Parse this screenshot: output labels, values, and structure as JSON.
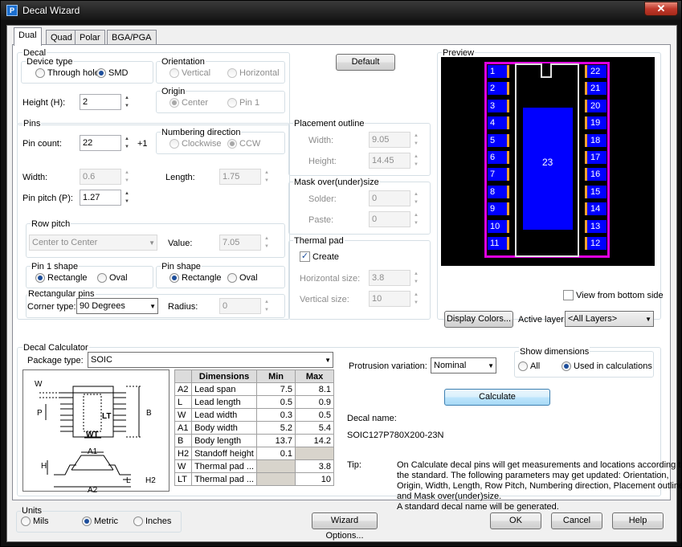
{
  "window": {
    "title": "Decal Wizard",
    "close": "✕"
  },
  "tabs": [
    "Dual",
    "Quad",
    "Polar",
    "BGA/PGA"
  ],
  "decal": {
    "group": "Decal",
    "device_type": {
      "label": "Device type",
      "through_hole": "Through hole",
      "smd": "SMD"
    },
    "orientation": {
      "label": "Orientation",
      "vertical": "Vertical",
      "horizontal": "Horizontal"
    },
    "height_label": "Height (H):",
    "height_value": "2",
    "origin": {
      "label": "Origin",
      "center": "Center",
      "pin1": "Pin 1"
    },
    "default_button": "Default"
  },
  "pins": {
    "group": "Pins",
    "pin_count_label": "Pin count:",
    "pin_count_value": "22",
    "plus1": "+1",
    "numbering": {
      "label": "Numbering direction",
      "clockwise": "Clockwise",
      "ccw": "CCW"
    },
    "width_label": "Width:",
    "width_value": "0.6",
    "length_label": "Length:",
    "length_value": "1.75",
    "pitch_label": "Pin pitch (P):",
    "pitch_value": "1.27",
    "row_pitch": {
      "label": "Row pitch",
      "mode": "Center to Center",
      "value_label": "Value:",
      "value": "7.05"
    },
    "pin1_shape": {
      "label": "Pin 1 shape",
      "rectangle": "Rectangle",
      "oval": "Oval"
    },
    "pin_shape": {
      "label": "Pin shape",
      "rectangle": "Rectangle",
      "oval": "Oval"
    },
    "rect_pins": {
      "label": "Rectangular pins",
      "corner_label": "Corner type:",
      "corner_value": "90 Degrees",
      "radius_label": "Radius:",
      "radius_value": "0"
    }
  },
  "placement": {
    "label": "Placement outline",
    "width_label": "Width:",
    "width_value": "9.05",
    "height_label": "Height:",
    "height_value": "14.45"
  },
  "mask": {
    "label": "Mask over(under)size",
    "solder_label": "Solder:",
    "solder_value": "0",
    "paste_label": "Paste:",
    "paste_value": "0"
  },
  "thermal": {
    "label": "Thermal pad",
    "create": "Create",
    "check": "✓",
    "hsize_label": "Horizontal size:",
    "hsize_value": "3.8",
    "vsize_label": "Vertical size:",
    "vsize_value": "10"
  },
  "preview": {
    "label": "Preview",
    "left_pins": [
      "1",
      "2",
      "3",
      "4",
      "5",
      "6",
      "7",
      "8",
      "9",
      "10",
      "11"
    ],
    "right_pins": [
      "22",
      "21",
      "20",
      "19",
      "18",
      "17",
      "16",
      "15",
      "14",
      "13",
      "12"
    ],
    "thermal_label": "23",
    "view_bottom": "View from bottom side",
    "display_colors": "Display Colors...",
    "active_layer_label": "Active layer:",
    "active_layer_value": "<All Layers>"
  },
  "calculator": {
    "label": "Decal Calculator",
    "package_label": "Package type:",
    "package_value": "SOIC",
    "protrusion_label": "Protrusion variation:",
    "protrusion_value": "Nominal",
    "show_dims": {
      "label": "Show dimensions",
      "all": "All",
      "used": "Used in calculations"
    },
    "calculate": "Calculate",
    "decal_name_label": "Decal name:",
    "decal_name_value": "SOIC127P780X200-23N",
    "tip_label": "Tip:",
    "tip_lines": [
      "On Calculate decal pins will get measurements and locations according to",
      "the standard. The following parameters may get updated: Orientation,",
      "Origin, Width, Length, Row Pitch, Numbering direction, Placement outline",
      "and Mask over(under)size.",
      "A standard decal name will be generated."
    ],
    "diagram": {
      "W": "W",
      "P": "P",
      "B": "B",
      "LT": "LT",
      "WT": "WT",
      "A1": "A1",
      "H": "H",
      "L": "L",
      "H2": "H2",
      "A2": "A2"
    },
    "table": {
      "headers": [
        "",
        "Dimensions",
        "Min",
        "Max"
      ],
      "rows": [
        {
          "code": "A2",
          "name": "Lead span",
          "min": "7.5",
          "max": "8.1"
        },
        {
          "code": "L",
          "name": "Lead length",
          "min": "0.5",
          "max": "0.9"
        },
        {
          "code": "W",
          "name": "Lead width",
          "min": "0.3",
          "max": "0.5"
        },
        {
          "code": "A1",
          "name": "Body width",
          "min": "5.2",
          "max": "5.4"
        },
        {
          "code": "B",
          "name": "Body length",
          "min": "13.7",
          "max": "14.2"
        },
        {
          "code": "H2",
          "name": "Standoff height",
          "min": "0.1",
          "max": ""
        },
        {
          "code": "W",
          "name": "Thermal pad ...",
          "min": "",
          "max": "3.8"
        },
        {
          "code": "LT",
          "name": "Thermal pad ...",
          "min": "",
          "max": "10"
        }
      ]
    }
  },
  "units": {
    "label": "Units",
    "mils": "Mils",
    "metric": "Metric",
    "inches": "Inches"
  },
  "footer": {
    "wizard_options": "Wizard Options...",
    "ok": "OK",
    "cancel": "Cancel",
    "help": "Help"
  }
}
